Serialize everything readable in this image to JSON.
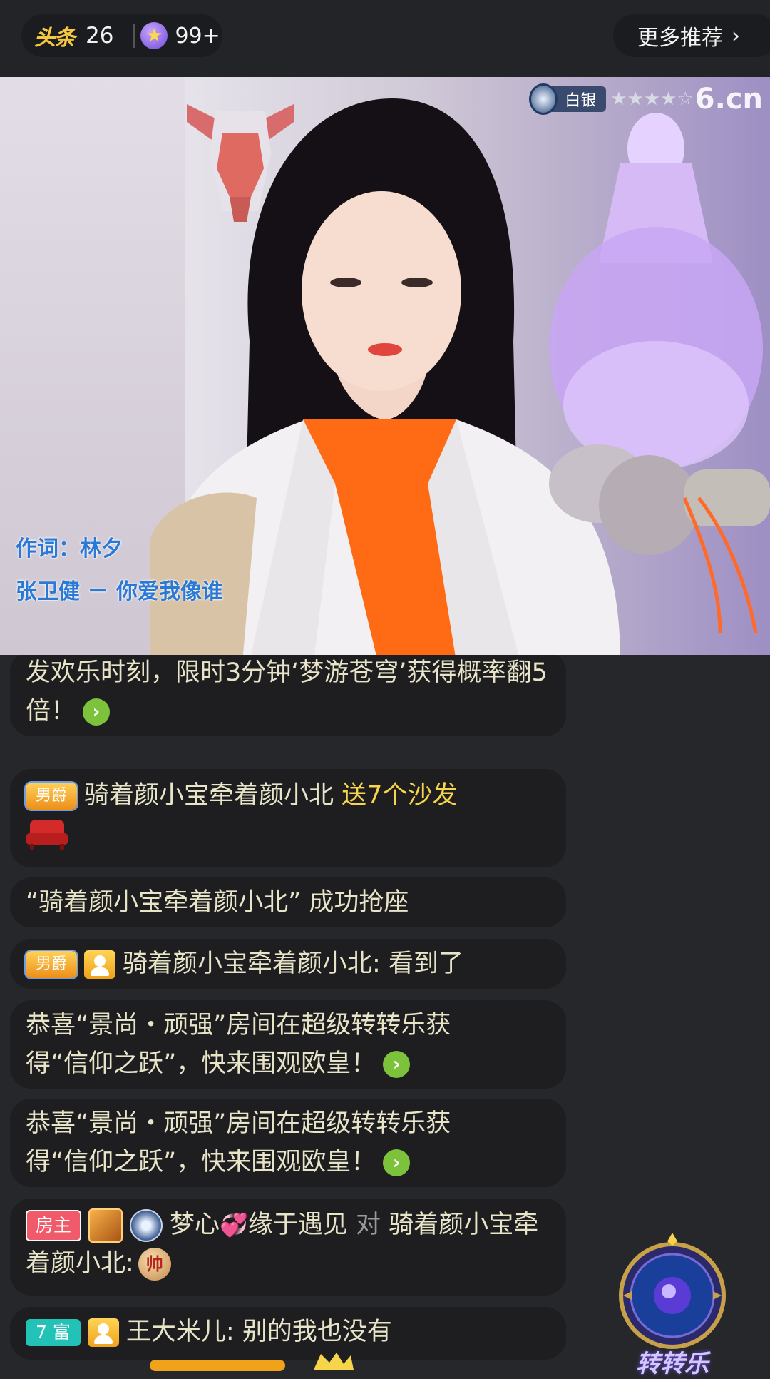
{
  "topbar": {
    "headline_logo": "头条",
    "headline_count": "26",
    "star_count": "99+",
    "more_label": "更多推荐",
    "more_chevron": "›"
  },
  "video": {
    "badge_level": "白银",
    "badge_stars": "★★★★☆",
    "watermark": "6.cn",
    "lyric_line1": "作词：林夕",
    "lyric_line2": "张卫健 － 你爱我像谁"
  },
  "chat": {
    "m1": {
      "text": "发欢乐时刻，限时3分钟‘梦游苍穹’获得概率翻5倍！",
      "arrow": "›"
    },
    "m2": {
      "tag": "男爵",
      "user": "骑着颜小宝牵着颜小北",
      "gift": "送7个沙发"
    },
    "m3": {
      "text": "“骑着颜小宝牵着颜小北”  成功抢座"
    },
    "m4": {
      "tag": "男爵",
      "user": "骑着颜小宝牵着颜小北:",
      "text": "看到了"
    },
    "m5": {
      "text": "恭喜“景尚・顽强”房间在超级转转乐获得“信仰之跃”，快来围观欧皇！",
      "arrow": "›"
    },
    "m6": {
      "text": "恭喜“景尚・顽强”房间在超级转转乐获得“信仰之跃”，快来围观欧皇！",
      "arrow": "›"
    },
    "m7": {
      "tag": "房主",
      "user_a": "梦心",
      "heart": "💞",
      "user_a2": "缘于遇见",
      "to": "对",
      "user_b": "骑着颜小宝牵着颜小北:",
      "emoji": "帅"
    },
    "m8": {
      "tag": "7 富",
      "user": "王大米儿:",
      "text": "别的我也没有"
    }
  },
  "widget": {
    "label": "转转乐"
  },
  "colors": {
    "background": "#26272b",
    "bubble": "#1e1e21",
    "highlight": "#f7d54a",
    "text": "#e8e4c8",
    "go": "#7cc23b"
  }
}
